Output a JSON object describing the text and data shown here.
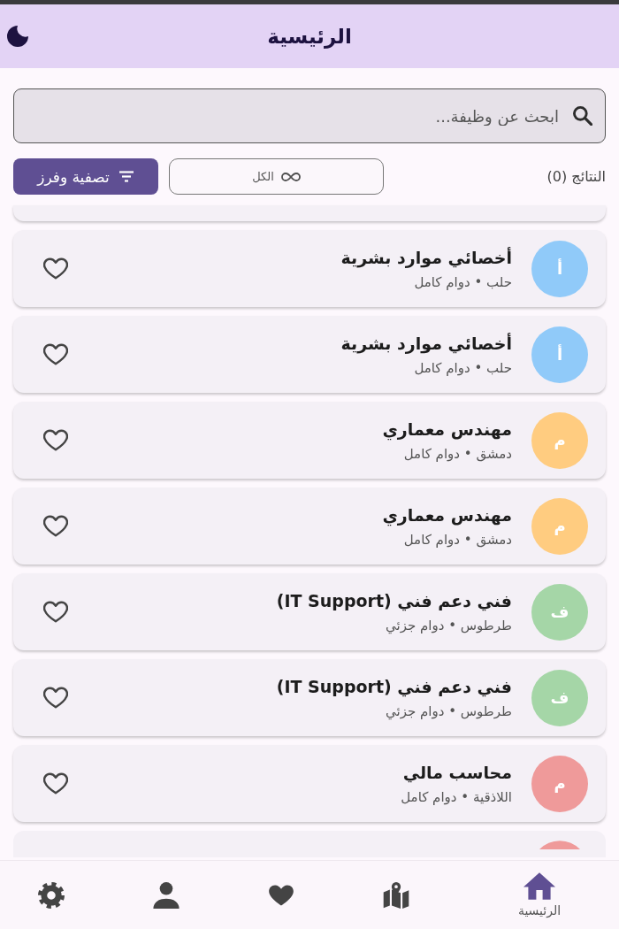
{
  "app_bar": {
    "title": "الرئيسية"
  },
  "search": {
    "placeholder": "ابحث عن وظيفة..."
  },
  "results": {
    "label": "النتائج (0)"
  },
  "category_chip": {
    "label": "الكل"
  },
  "filter_button": {
    "label": "تصفية وفرز"
  },
  "jobs": {
    "clipped_above": true,
    "items": [
      {
        "initial": "أ",
        "color": "#90caf9",
        "title": "أخصائي موارد بشرية",
        "meta": "حلب • دوام كامل",
        "favorite": false
      },
      {
        "initial": "أ",
        "color": "#90caf9",
        "title": "أخصائي موارد بشرية",
        "meta": "حلب • دوام كامل",
        "favorite": false
      },
      {
        "initial": "م",
        "color": "#ffcc80",
        "title": "مهندس معماري",
        "meta": "دمشق • دوام كامل",
        "favorite": false
      },
      {
        "initial": "م",
        "color": "#ffcc80",
        "title": "مهندس معماري",
        "meta": "دمشق • دوام كامل",
        "favorite": false
      },
      {
        "initial": "ف",
        "color": "#a5d6a7",
        "title": "فني دعم فني (IT Support)",
        "meta": "طرطوس • دوام جزئي",
        "favorite": false
      },
      {
        "initial": "ف",
        "color": "#a5d6a7",
        "title": "فني دعم فني (IT Support)",
        "meta": "طرطوس • دوام جزئي",
        "favorite": false
      },
      {
        "initial": "م",
        "color": "#ef9a9a",
        "title": "محاسب مالي",
        "meta": "اللاذقية • دوام كامل",
        "favorite": false
      }
    ],
    "clipped_below": {
      "color": "#ef9a9a"
    }
  },
  "bottom_nav": [
    {
      "kind": "home",
      "label": "الرئيسية",
      "selected": true
    },
    {
      "kind": "map",
      "selected": false
    },
    {
      "kind": "favorites",
      "selected": false
    },
    {
      "kind": "profile",
      "selected": false
    },
    {
      "kind": "settings",
      "selected": false
    }
  ]
}
